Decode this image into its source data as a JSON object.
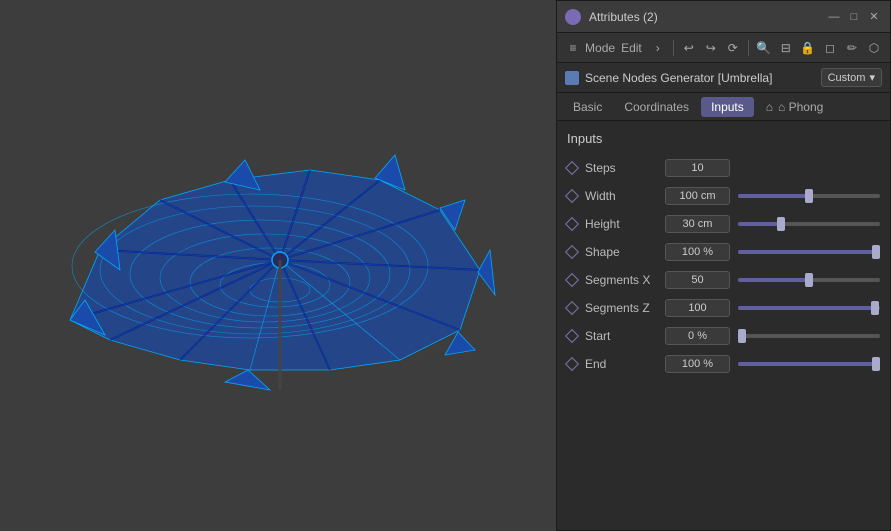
{
  "window": {
    "title": "Attributes (2)",
    "min_label": "—",
    "max_label": "□",
    "close_label": "✕"
  },
  "toolbar": {
    "menu_label": "≡",
    "mode_label": "Mode",
    "edit_label": "Edit",
    "chevron_label": "›",
    "undo_label": "↩",
    "redo_label": "↪",
    "toolbar_icons": [
      "↩",
      "↪",
      "⤺",
      "🔍",
      "⊟",
      "🔒",
      "◻",
      "✏",
      "⬡"
    ]
  },
  "nodebar": {
    "node_name": "Scene Nodes Generator [Umbrella]",
    "dropdown_label": "Custom",
    "dropdown_arrow": "▾"
  },
  "tabs": [
    {
      "id": "basic",
      "label": "Basic",
      "active": false
    },
    {
      "id": "coordinates",
      "label": "Coordinates",
      "active": false
    },
    {
      "id": "inputs",
      "label": "Inputs",
      "active": true
    },
    {
      "id": "phong",
      "label": "⌂ Phong",
      "active": false
    }
  ],
  "inputs_section": {
    "title": "Inputs",
    "params": [
      {
        "id": "steps",
        "label": "Steps",
        "value": "10",
        "has_slider": false
      },
      {
        "id": "width",
        "label": "Width",
        "value": "100 cm",
        "has_slider": true,
        "fill_pct": 50
      },
      {
        "id": "height",
        "label": "Height",
        "value": "30 cm",
        "has_slider": true,
        "fill_pct": 30,
        "thumb_pct": 30
      },
      {
        "id": "shape",
        "label": "Shape",
        "value": "100 %",
        "has_slider": true,
        "fill_pct": 100,
        "thumb_pct": 100
      },
      {
        "id": "segments_x",
        "label": "Segments X",
        "value": "50",
        "has_slider": true,
        "fill_pct": 50,
        "thumb_pct": 50
      },
      {
        "id": "segments_z",
        "label": "Segments Z",
        "value": "100",
        "has_slider": true,
        "fill_pct": 100,
        "thumb_pct": 99
      },
      {
        "id": "start",
        "label": "Start",
        "value": "0 %",
        "has_slider": true,
        "fill_pct": 0,
        "thumb_pct": 0
      },
      {
        "id": "end",
        "label": "End",
        "value": "100 %",
        "has_slider": true,
        "fill_pct": 100,
        "thumb_pct": 100
      }
    ]
  },
  "colors": {
    "accent": "#6060a0",
    "tab_active": "#5a5a8a",
    "diamond": "#7a7aaa",
    "slider_fill": "#6868b0",
    "slider_thumb": "#aaaacc"
  }
}
